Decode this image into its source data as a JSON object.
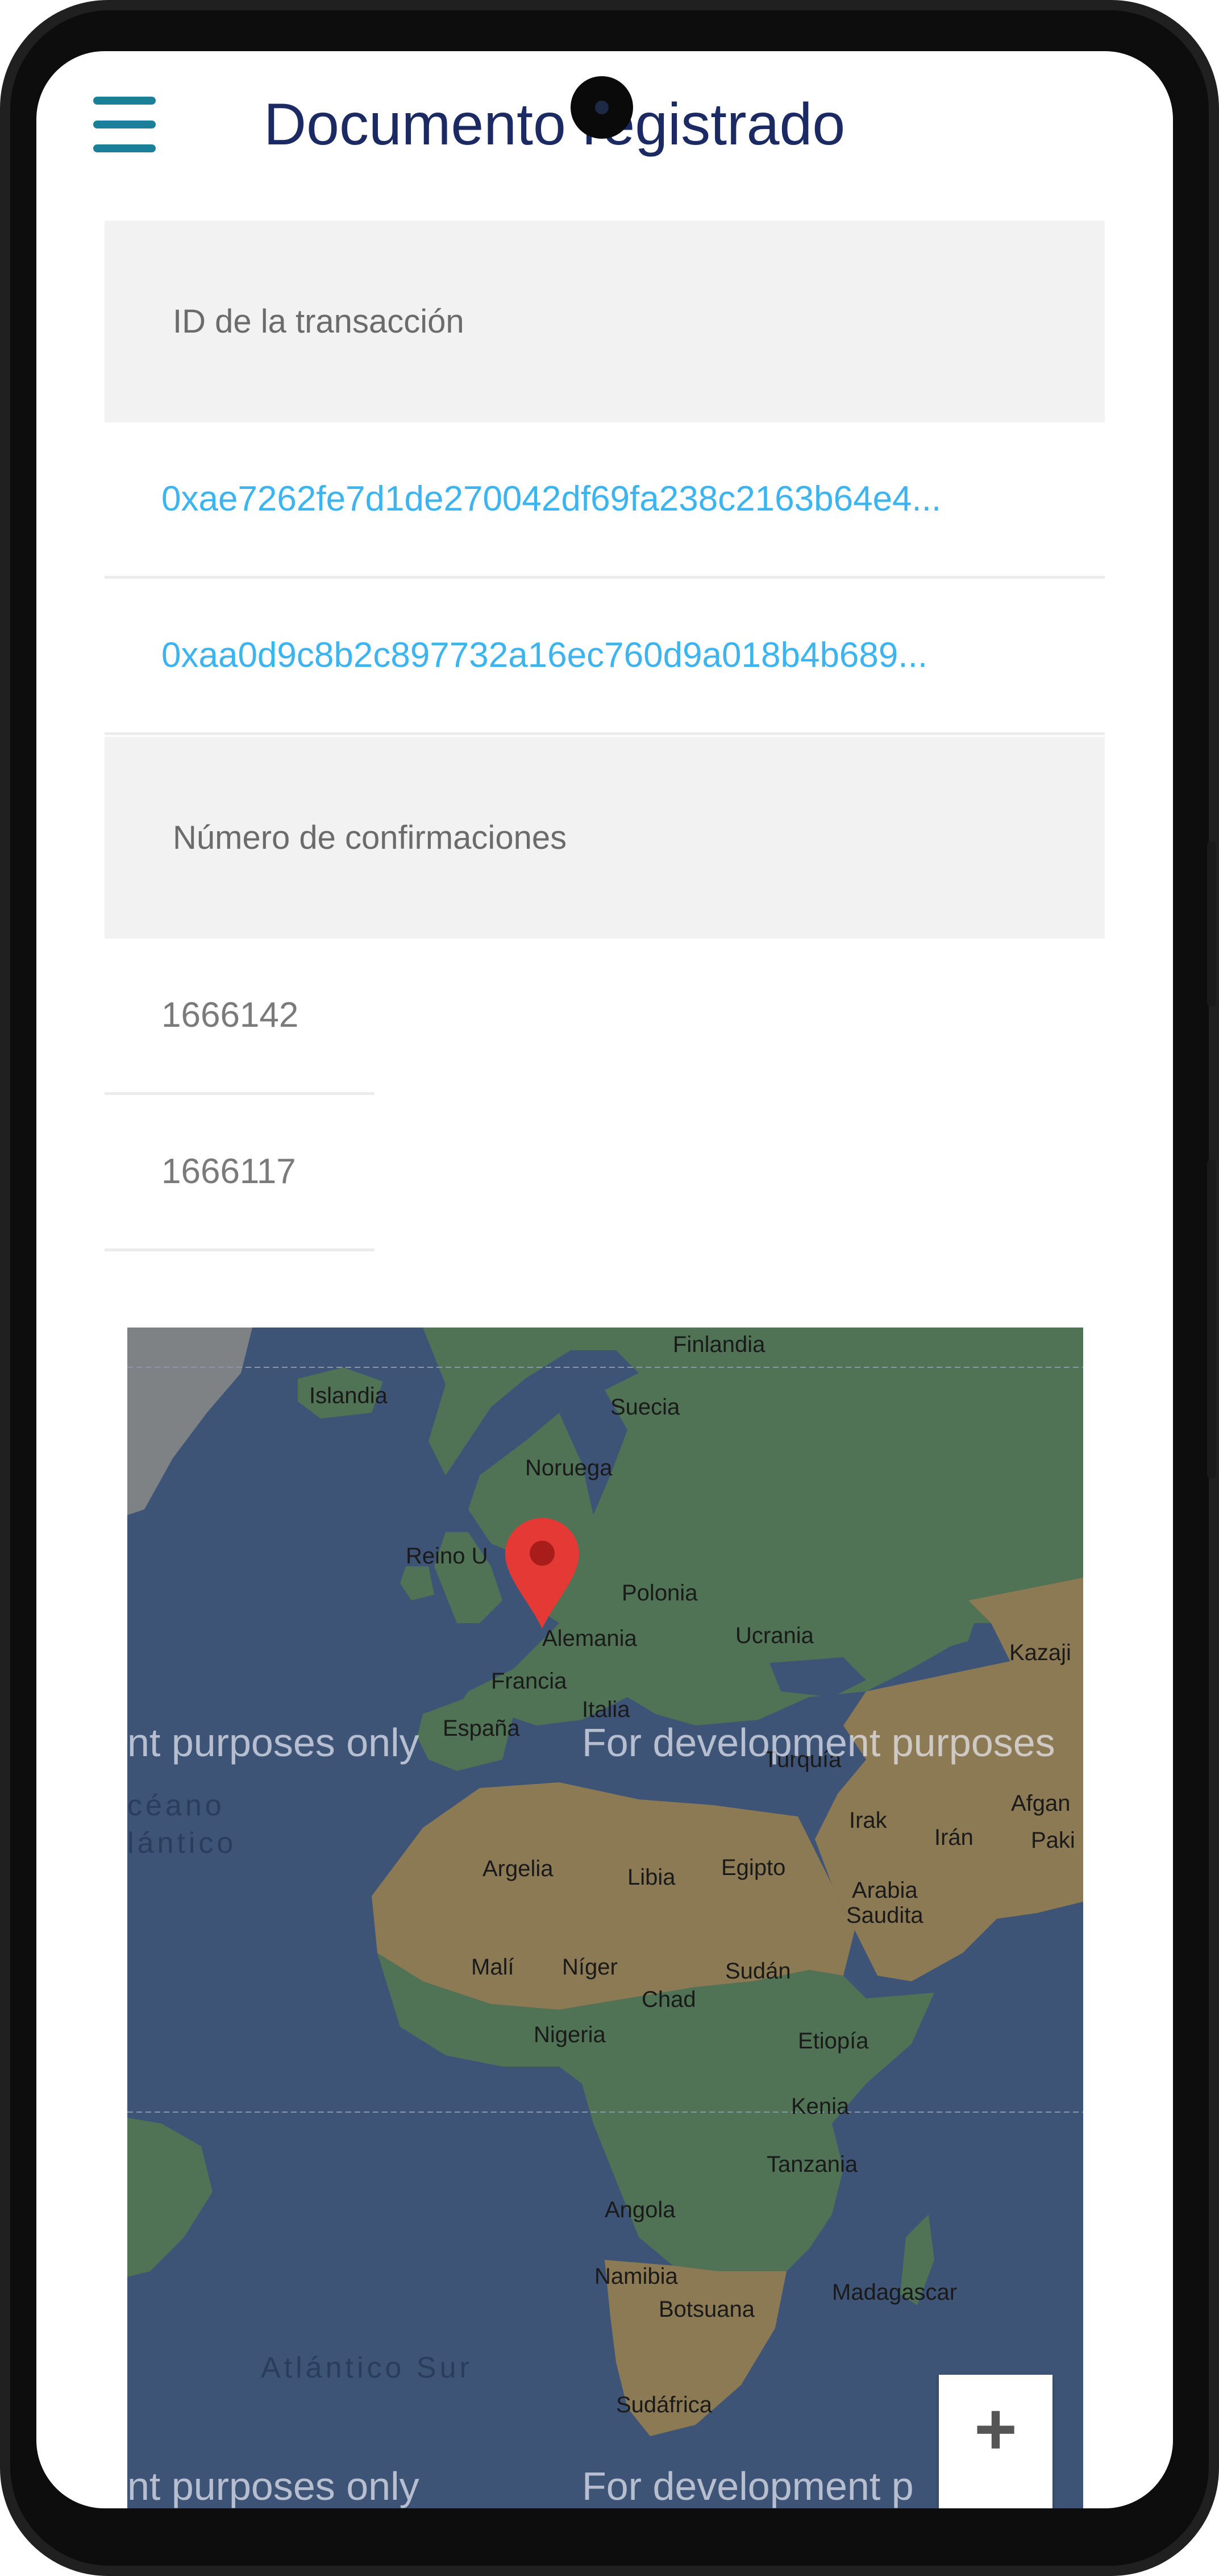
{
  "header": {
    "title": "Documento registrado"
  },
  "tx_section": {
    "label": "ID de la transacción",
    "ids": [
      "0xae7262fe7d1de270042df69fa238c2163b64e4...",
      "0xaa0d9c8b2c897732a16ec760d9a018b4b689..."
    ]
  },
  "conf_section": {
    "label": "Número de confirmaciones",
    "values": [
      "1666142",
      "1666117"
    ]
  },
  "map": {
    "watermark": "For development purposes only",
    "watermark_left": "nt purposes only",
    "watermark_right": "For development purposes",
    "watermark_bottom_left": "nt purposes only",
    "watermark_bottom_right": "For development p",
    "zoom_in": "+",
    "oceans": {
      "north": "céano\nlántico",
      "south": "Atlántico Sur"
    },
    "countries": {
      "finlandia": "Finlandia",
      "islandia": "Islandia",
      "suecia": "Suecia",
      "noruega": "Noruega",
      "reino_unido": "Reino U",
      "polonia": "Polonia",
      "alemania": "Alemania",
      "ucrania": "Ucrania",
      "kazajistan": "Kazaji",
      "francia": "Francia",
      "espana": "España",
      "italia": "Italia",
      "turquia": "Turquía",
      "irak": "Irak",
      "iran": "Irán",
      "afganistan": "Afgan",
      "pakistan": "Paki",
      "argelia": "Argelia",
      "libia": "Libia",
      "egipto": "Egipto",
      "arabia": "Arabia\nSaudita",
      "mali": "Malí",
      "niger": "Níger",
      "chad": "Chad",
      "sudan": "Sudán",
      "nigeria": "Nigeria",
      "etiopia": "Etiopía",
      "kenia": "Kenia",
      "tanzania": "Tanzania",
      "angola": "Angola",
      "namibia": "Namibia",
      "botsuana": "Botsuana",
      "madagascar": "Madagascar",
      "sudafrica": "Sudáfrica"
    },
    "colors": {
      "water": "#3d5477",
      "land_green": "#4f7354",
      "land_desert": "#8b7a54",
      "marker": "#e53935"
    }
  }
}
